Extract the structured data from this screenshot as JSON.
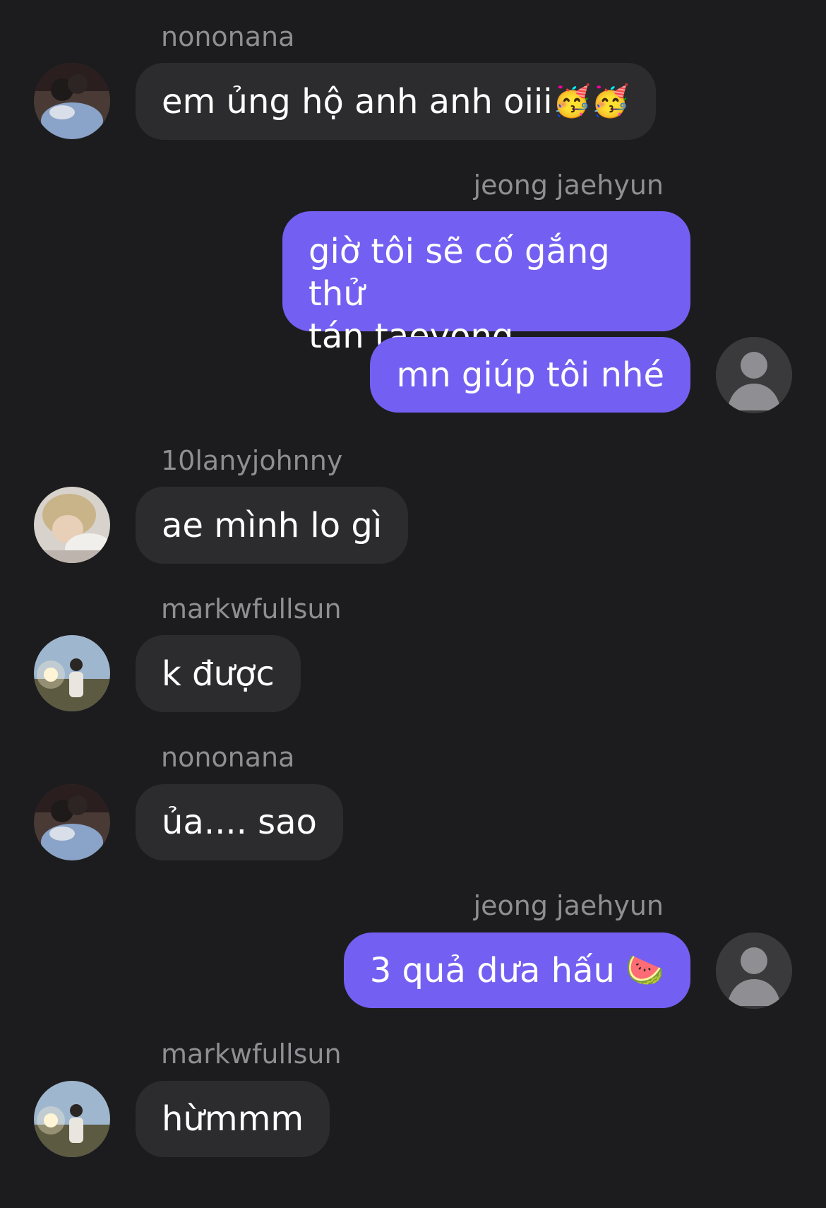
{
  "messages": [
    {
      "sender": "nononana",
      "text": "em ủng hộ anh anh oiii",
      "emoji": "🥳🥳"
    },
    {
      "sender": "jeong jaehyun",
      "lines": [
        "giờ tôi sẽ cố gắng thử",
        "tán taeyong"
      ]
    },
    {
      "text": "mn giúp tôi nhé"
    },
    {
      "sender": "10lanyjohnny",
      "text": "ae mình lo gì"
    },
    {
      "sender": "markwfullsun",
      "text": "k được"
    },
    {
      "sender": "nononana",
      "text": "ủa.... sao"
    },
    {
      "sender": "jeong jaehyun",
      "text": "3 quả dưa hấu",
      "emoji": "🍉"
    },
    {
      "sender": "markwfullsun",
      "text": "hừmmm"
    }
  ],
  "colors": {
    "background": "#1c1c1e",
    "incoming_bubble": "#2c2c2e",
    "outgoing_bubble": "#7360f2",
    "sender_name": "#8e8e93",
    "text": "#ffffff"
  },
  "icons": {
    "default_avatar": "person-silhouette-icon"
  }
}
